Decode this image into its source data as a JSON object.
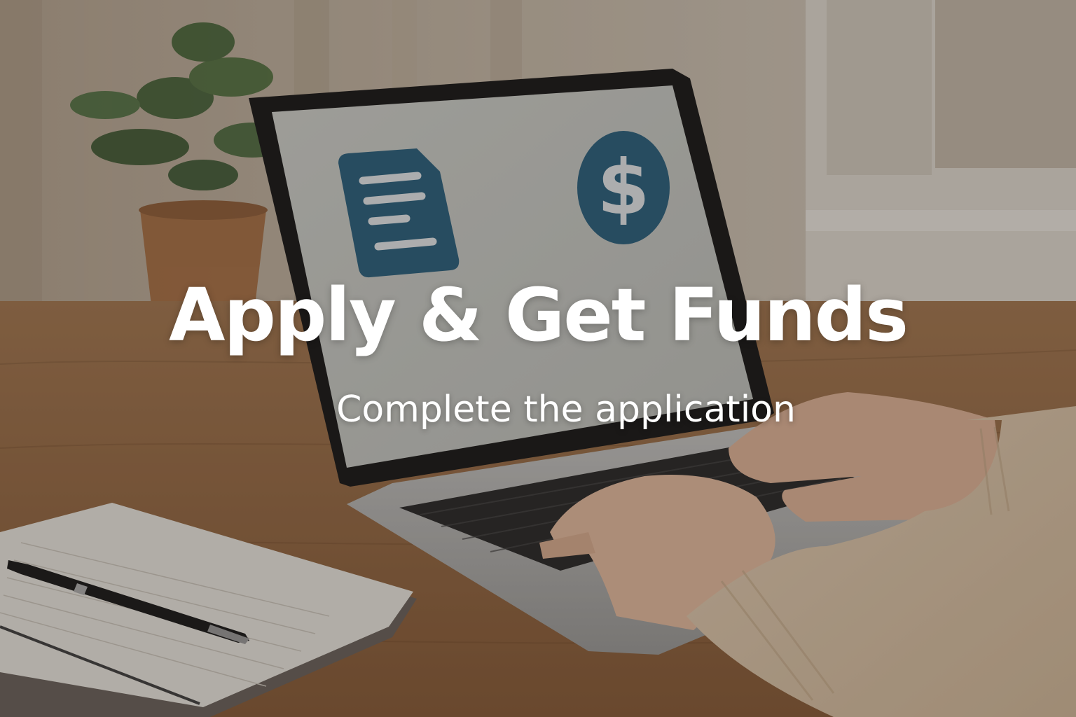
{
  "hero": {
    "title": "Apply & Get Funds",
    "subtitle": "Complete the application"
  },
  "scene": {
    "description_icons": [
      "document-icon",
      "dollar-coin-icon"
    ],
    "colors": {
      "screen_accent": "#2e6482",
      "screen_background": "#c9cbc6",
      "desk_wood": "#9a6e47",
      "text": "#ffffff"
    }
  }
}
